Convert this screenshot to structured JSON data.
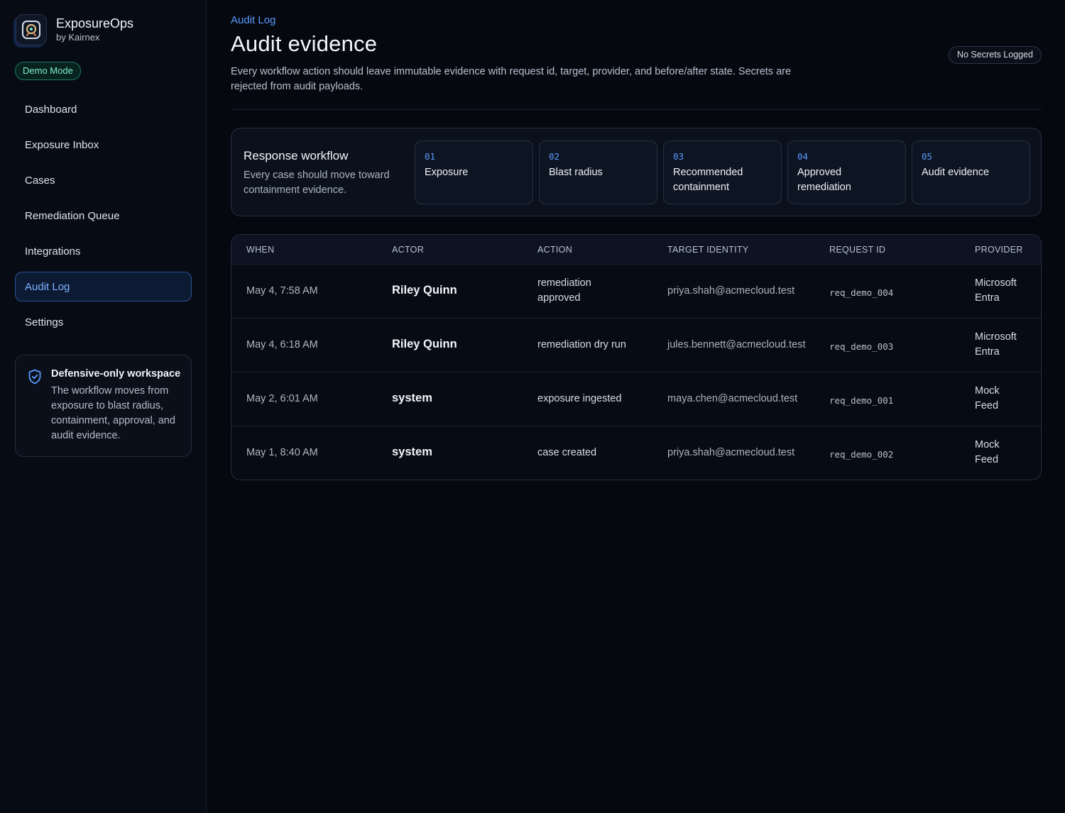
{
  "brand": {
    "name": "ExposureOps",
    "sub": "by Kairnex"
  },
  "demo_badge": "Demo Mode",
  "nav": [
    {
      "label": "Dashboard",
      "active": false
    },
    {
      "label": "Exposure Inbox",
      "active": false
    },
    {
      "label": "Cases",
      "active": false
    },
    {
      "label": "Remediation Queue",
      "active": false
    },
    {
      "label": "Integrations",
      "active": false
    },
    {
      "label": "Audit Log",
      "active": true
    },
    {
      "label": "Settings",
      "active": false
    }
  ],
  "info_card": {
    "icon": "shield-check-icon",
    "title": "Defensive-only workspace",
    "body": "The workflow moves from exposure to blast radius, containment, approval, and audit evidence."
  },
  "header": {
    "breadcrumb": "Audit Log",
    "title": "Audit evidence",
    "description": "Every workflow action should leave immutable evidence with request id, target, provider, and before/after state. Secrets are rejected from audit payloads.",
    "badge": "No Secrets Logged"
  },
  "workflow": {
    "title": "Response workflow",
    "subtitle": "Every case should move toward containment evidence.",
    "steps": [
      {
        "num": "01",
        "label": "Exposure"
      },
      {
        "num": "02",
        "label": "Blast radius"
      },
      {
        "num": "03",
        "label": "Recommended containment"
      },
      {
        "num": "04",
        "label": "Approved remediation"
      },
      {
        "num": "05",
        "label": "Audit evidence"
      }
    ]
  },
  "table": {
    "columns": [
      "WHEN",
      "ACTOR",
      "ACTION",
      "TARGET IDENTITY",
      "REQUEST ID",
      "PROVIDER"
    ],
    "rows": [
      {
        "when": "May 4, 7:58 AM",
        "actor": "Riley Quinn",
        "action": "remediation approved",
        "target": "priya.shah@acmecloud.test",
        "request_id": "req_demo_004",
        "provider": "Microsoft Entra"
      },
      {
        "when": "May 4, 6:18 AM",
        "actor": "Riley Quinn",
        "action": "remediation dry run",
        "target": "jules.bennett@acmecloud.test",
        "request_id": "req_demo_003",
        "provider": "Microsoft Entra"
      },
      {
        "when": "May 2, 6:01 AM",
        "actor": "system",
        "action": "exposure ingested",
        "target": "maya.chen@acmecloud.test",
        "request_id": "req_demo_001",
        "provider": "Mock Feed"
      },
      {
        "when": "May 1, 8:40 AM",
        "actor": "system",
        "action": "case created",
        "target": "priya.shah@acmecloud.test",
        "request_id": "req_demo_002",
        "provider": "Mock Feed"
      }
    ]
  }
}
